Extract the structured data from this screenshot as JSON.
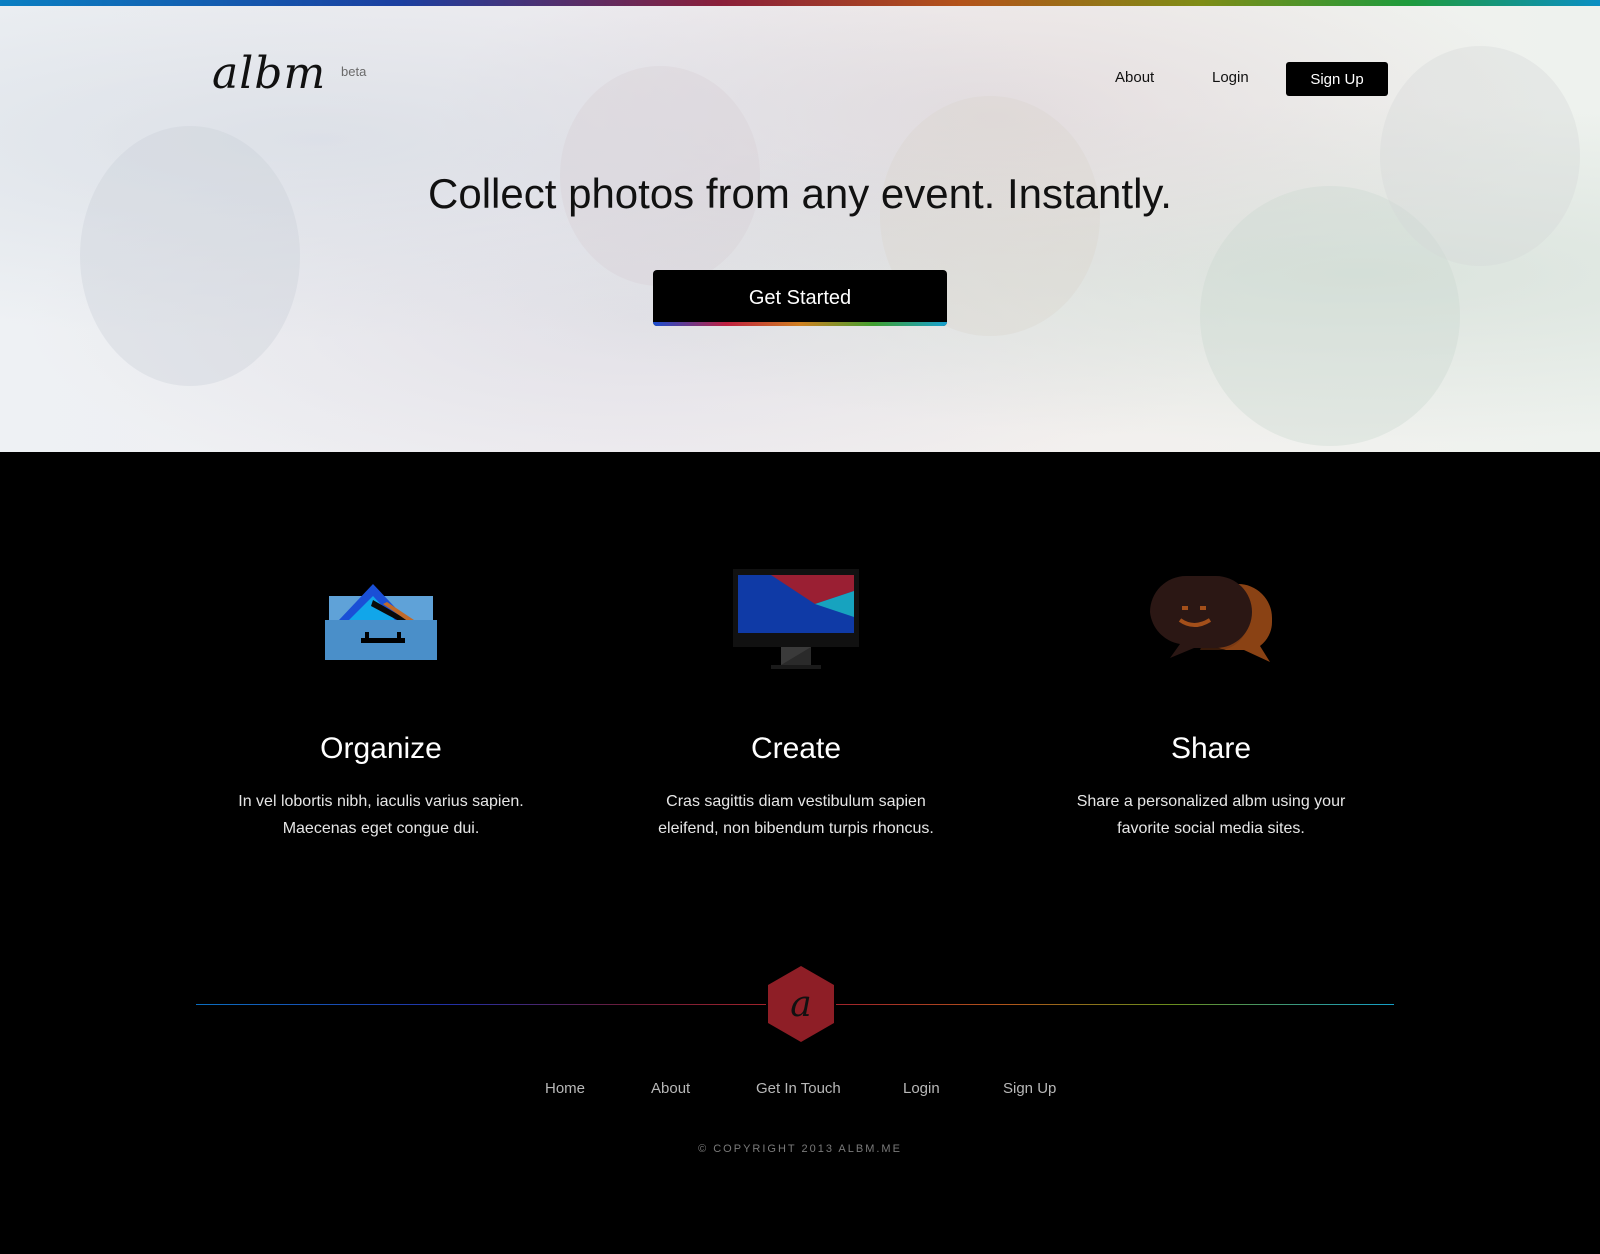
{
  "header": {
    "logo_text": "albm",
    "beta_label": "beta",
    "nav": {
      "about": "About",
      "login": "Login",
      "signup": "Sign Up"
    }
  },
  "hero": {
    "headline": "Collect photos from any event. Instantly.",
    "cta_label": "Get Started"
  },
  "features": [
    {
      "icon": "drawer-icon",
      "title": "Organize",
      "desc_line1": "In vel lobortis nibh, iaculis varius sapien.",
      "desc_line2": "Maecenas eget congue dui."
    },
    {
      "icon": "monitor-icon",
      "title": "Create",
      "desc_line1": "Cras sagittis diam vestibulum sapien",
      "desc_line2": "eleifend, non bibendum turpis rhoncus."
    },
    {
      "icon": "chat-bubbles-icon",
      "title": "Share",
      "desc_line1": "Share a personalized albm using your",
      "desc_line2": "favorite social media sites."
    }
  ],
  "footer": {
    "emblem_letter": "a",
    "links": [
      "Home",
      "About",
      "Get In Touch",
      "Login",
      "Sign Up"
    ],
    "copyright": "© COPYRIGHT 2013 ALBM.ME"
  },
  "colors": {
    "accent_red": "#8e1e26",
    "drawer_blue": "#4a8fc9",
    "chat_brown": "#8a4214"
  }
}
